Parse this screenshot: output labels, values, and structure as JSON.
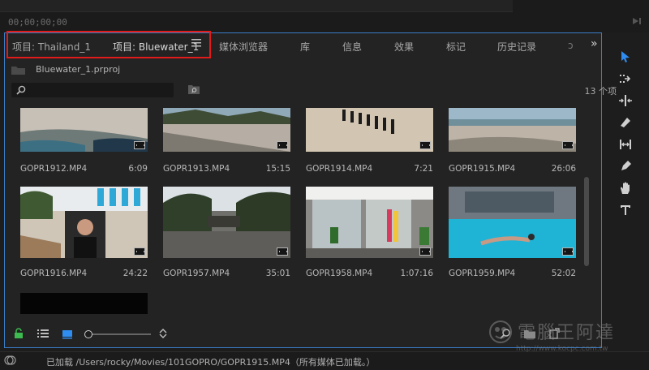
{
  "header": {
    "timecode": "00;00;00;00"
  },
  "tabs": [
    {
      "label": "项目: Thailand_1"
    },
    {
      "label": "项目: Bluewater_1"
    },
    {
      "label": "媒体浏览器"
    },
    {
      "label": "库"
    },
    {
      "label": "信息"
    },
    {
      "label": "效果"
    },
    {
      "label": "标记"
    },
    {
      "label": "历史记录"
    }
  ],
  "overflow_glyph": "»",
  "project": {
    "filename": "Bluewater_1.prproj",
    "item_count": "13 个项"
  },
  "search": {
    "placeholder": ""
  },
  "clips": [
    {
      "name": "GOPR1912.MP4",
      "duration": "6:09"
    },
    {
      "name": "GOPR1913.MP4",
      "duration": "15:15"
    },
    {
      "name": "GOPR1914.MP4",
      "duration": "7:21"
    },
    {
      "name": "GOPR1915.MP4",
      "duration": "26:06"
    },
    {
      "name": "GOPR1916.MP4",
      "duration": "24:22"
    },
    {
      "name": "GOPR1957.MP4",
      "duration": "35:01"
    },
    {
      "name": "GOPR1958.MP4",
      "duration": "1:07:16"
    },
    {
      "name": "GOPR1959.MP4",
      "duration": "52:02"
    }
  ],
  "status": {
    "text": "已加载 /Users/rocky/Movies/101GOPRO/GOPR1915.MP4（所有媒体已加载。）"
  },
  "watermark": {
    "text": "電腦王阿達",
    "url": "http://www.kocpc.com.tw"
  },
  "colors": {
    "accent": "#3a7ec9",
    "highlight": "#e11a1a",
    "lock": "#3dbb50",
    "tool_active": "#2f8cf0"
  }
}
